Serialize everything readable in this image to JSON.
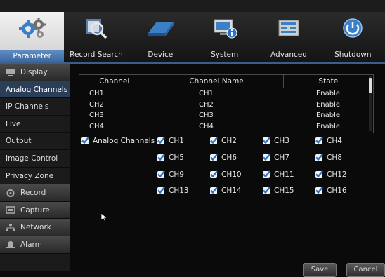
{
  "nav": {
    "items": [
      {
        "label": "Parameter",
        "icon": "gears-icon",
        "active": true
      },
      {
        "label": "Record Search",
        "icon": "search-record-icon"
      },
      {
        "label": "Device",
        "icon": "hard-drive-icon"
      },
      {
        "label": "System",
        "icon": "system-info-icon"
      },
      {
        "label": "Advanced",
        "icon": "advanced-settings-icon"
      },
      {
        "label": "Shutdown",
        "icon": "power-icon"
      }
    ]
  },
  "sidebar": {
    "items": [
      {
        "label": "Display",
        "group": true,
        "icon": "monitor-icon"
      },
      {
        "label": "Analog Channels",
        "active": true
      },
      {
        "label": "IP Channels"
      },
      {
        "label": "Live"
      },
      {
        "label": "Output"
      },
      {
        "label": "Image Control"
      },
      {
        "label": "Privacy Zone"
      },
      {
        "label": "Record",
        "group": true,
        "icon": "record-gear-icon"
      },
      {
        "label": "Capture",
        "group": true,
        "icon": "capture-icon"
      },
      {
        "label": "Network",
        "group": true,
        "icon": "network-icon"
      },
      {
        "label": "Alarm",
        "group": true,
        "icon": "alarm-icon"
      }
    ]
  },
  "table": {
    "headers": [
      "Channel",
      "Channel Name",
      "State"
    ],
    "rows": [
      [
        "CH1",
        "CH1",
        "Enable"
      ],
      [
        "CH2",
        "CH2",
        "Enable"
      ],
      [
        "CH3",
        "CH3",
        "Enable"
      ],
      [
        "CH4",
        "CH4",
        "Enable"
      ]
    ]
  },
  "analog": {
    "all_label": "Analog Channels",
    "channels": [
      "CH1",
      "CH2",
      "CH3",
      "CH4",
      "CH5",
      "CH6",
      "CH7",
      "CH8",
      "CH9",
      "CH10",
      "CH11",
      "CH12",
      "CH13",
      "CH14",
      "CH15",
      "CH16"
    ]
  },
  "buttons": {
    "save": "Save",
    "cancel": "Cancel"
  },
  "colors": {
    "accent": "#3a669f",
    "check": "#2a72c8"
  }
}
